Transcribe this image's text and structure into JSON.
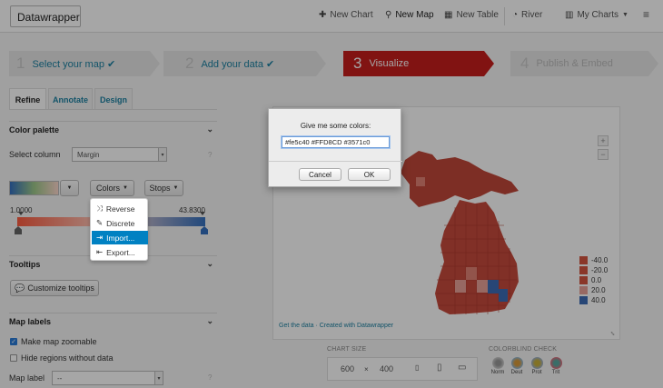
{
  "navbar": {
    "brand": "Datawrapper",
    "items": [
      {
        "label": "New Chart",
        "icon": "plus-icon"
      },
      {
        "label": "New Map",
        "icon": "map-marker-icon"
      },
      {
        "label": "New Table",
        "icon": "table-icon"
      },
      {
        "label": "River",
        "icon": "river-icon"
      },
      {
        "label": "My Charts",
        "icon": "bar-chart-icon"
      }
    ],
    "menu_icon": "hamburger-icon"
  },
  "steps": [
    {
      "num": "1",
      "label": "Select your map ✔",
      "state": "done"
    },
    {
      "num": "2",
      "label": "Add your data ✔",
      "state": "done"
    },
    {
      "num": "3",
      "label": "Visualize",
      "state": "active"
    },
    {
      "num": "4",
      "label": "Publish & Embed",
      "state": "todo"
    }
  ],
  "tabs": [
    "Refine",
    "Annotate",
    "Design"
  ],
  "color_palette": {
    "heading": "Color palette",
    "select_column_label": "Select column",
    "column_value": "Margin",
    "colors_button": "Colors",
    "stops_button": "Stops",
    "range_min": "1.0000",
    "range_max": "43.8300",
    "colors": {
      "low": "#fe5c40",
      "mid": "#FFD8CD",
      "high": "#3571c0"
    }
  },
  "colors_menu": {
    "items": [
      {
        "label": "Reverse",
        "icon": "shuffle-icon"
      },
      {
        "label": "Discrete",
        "icon": "pencil-icon"
      },
      {
        "label": "Import...",
        "icon": "sign-in-icon"
      },
      {
        "label": "Export...",
        "icon": "sign-out-icon"
      }
    ],
    "highlighted": "Import..."
  },
  "tooltips": {
    "heading": "Tooltips",
    "customize_button": "Customize tooltips"
  },
  "map_labels": {
    "heading": "Map labels",
    "zoomable_label": "Make map zoomable",
    "zoomable_checked": true,
    "hide_regions_label": "Hide regions without data",
    "hide_regions_checked": false,
    "map_label_label": "Map label",
    "map_label_value": "--"
  },
  "map": {
    "footer": "Get the data · Created with Datawrapper",
    "legend": [
      {
        "label": "-40.0",
        "color": "#d5553f"
      },
      {
        "label": "-20.0",
        "color": "#d5553f"
      },
      {
        "label": "0.0",
        "color": "#d5553f"
      },
      {
        "label": "20.0",
        "color": "#e8a198"
      },
      {
        "label": "40.0",
        "color": "#3d6cb5"
      }
    ]
  },
  "chart_size": {
    "caption": "CHART SIZE",
    "width": "600",
    "times": "×",
    "height": "400"
  },
  "colorblind": {
    "caption": "COLORBLIND CHECK",
    "modes": [
      "Norm",
      "Deut",
      "Prot",
      "Trit"
    ]
  },
  "dialog": {
    "message": "Give me some colors:",
    "input_value": "#fe5c40 #FFD8CD #3571c0",
    "cancel": "Cancel",
    "ok": "OK"
  }
}
